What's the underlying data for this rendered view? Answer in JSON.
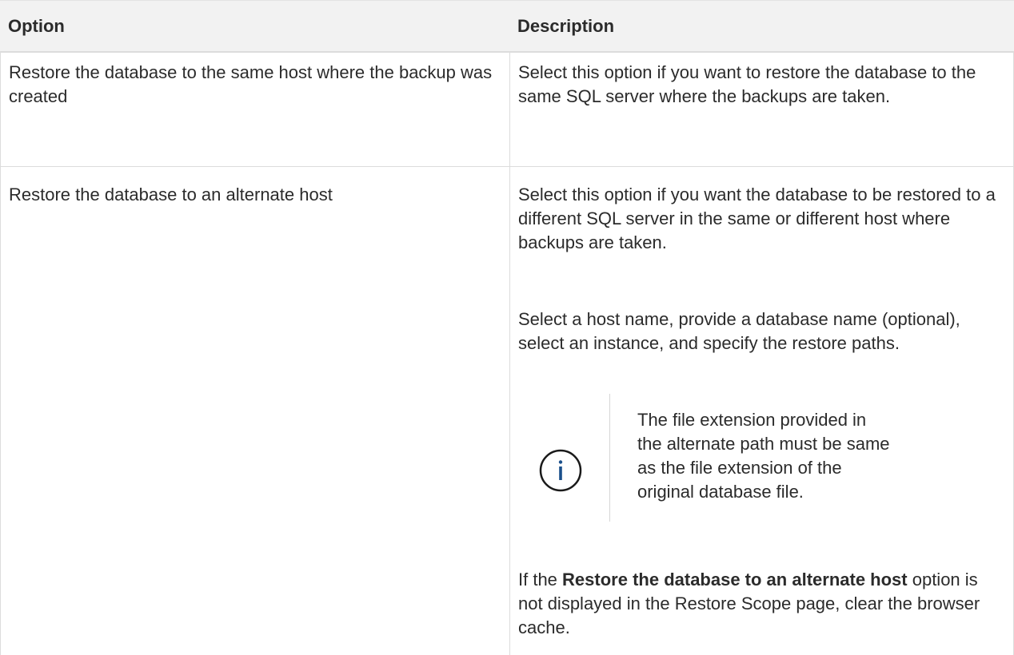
{
  "table": {
    "headers": {
      "option": "Option",
      "description": "Description"
    },
    "rows": [
      {
        "option": "Restore the database to the same host where the backup was created",
        "description": "Select this option if you want to restore the database to the same SQL server where the backups are taken."
      },
      {
        "option": "Restore the database to an alternate host",
        "description_p1": "Select this option if you want the database to be restored to a different SQL server in the same or different host where backups are taken.",
        "description_p2": "Select a host name, provide a database name (optional), select an instance, and specify the restore paths.",
        "note": {
          "icon": "info-icon",
          "text": "The file extension provided in the alternate path must be same as the file extension of the original database file."
        },
        "description_p4": {
          "pre": "If the ",
          "bold": "Restore the database to an alternate host",
          "post": " option is not displayed in the Restore Scope page, clear the browser cache."
        }
      }
    ]
  },
  "colors": {
    "header_bg": "#f2f2f2",
    "border": "#dcdcdc",
    "icon": "#1a4f8b",
    "text": "#2b2b2b"
  }
}
